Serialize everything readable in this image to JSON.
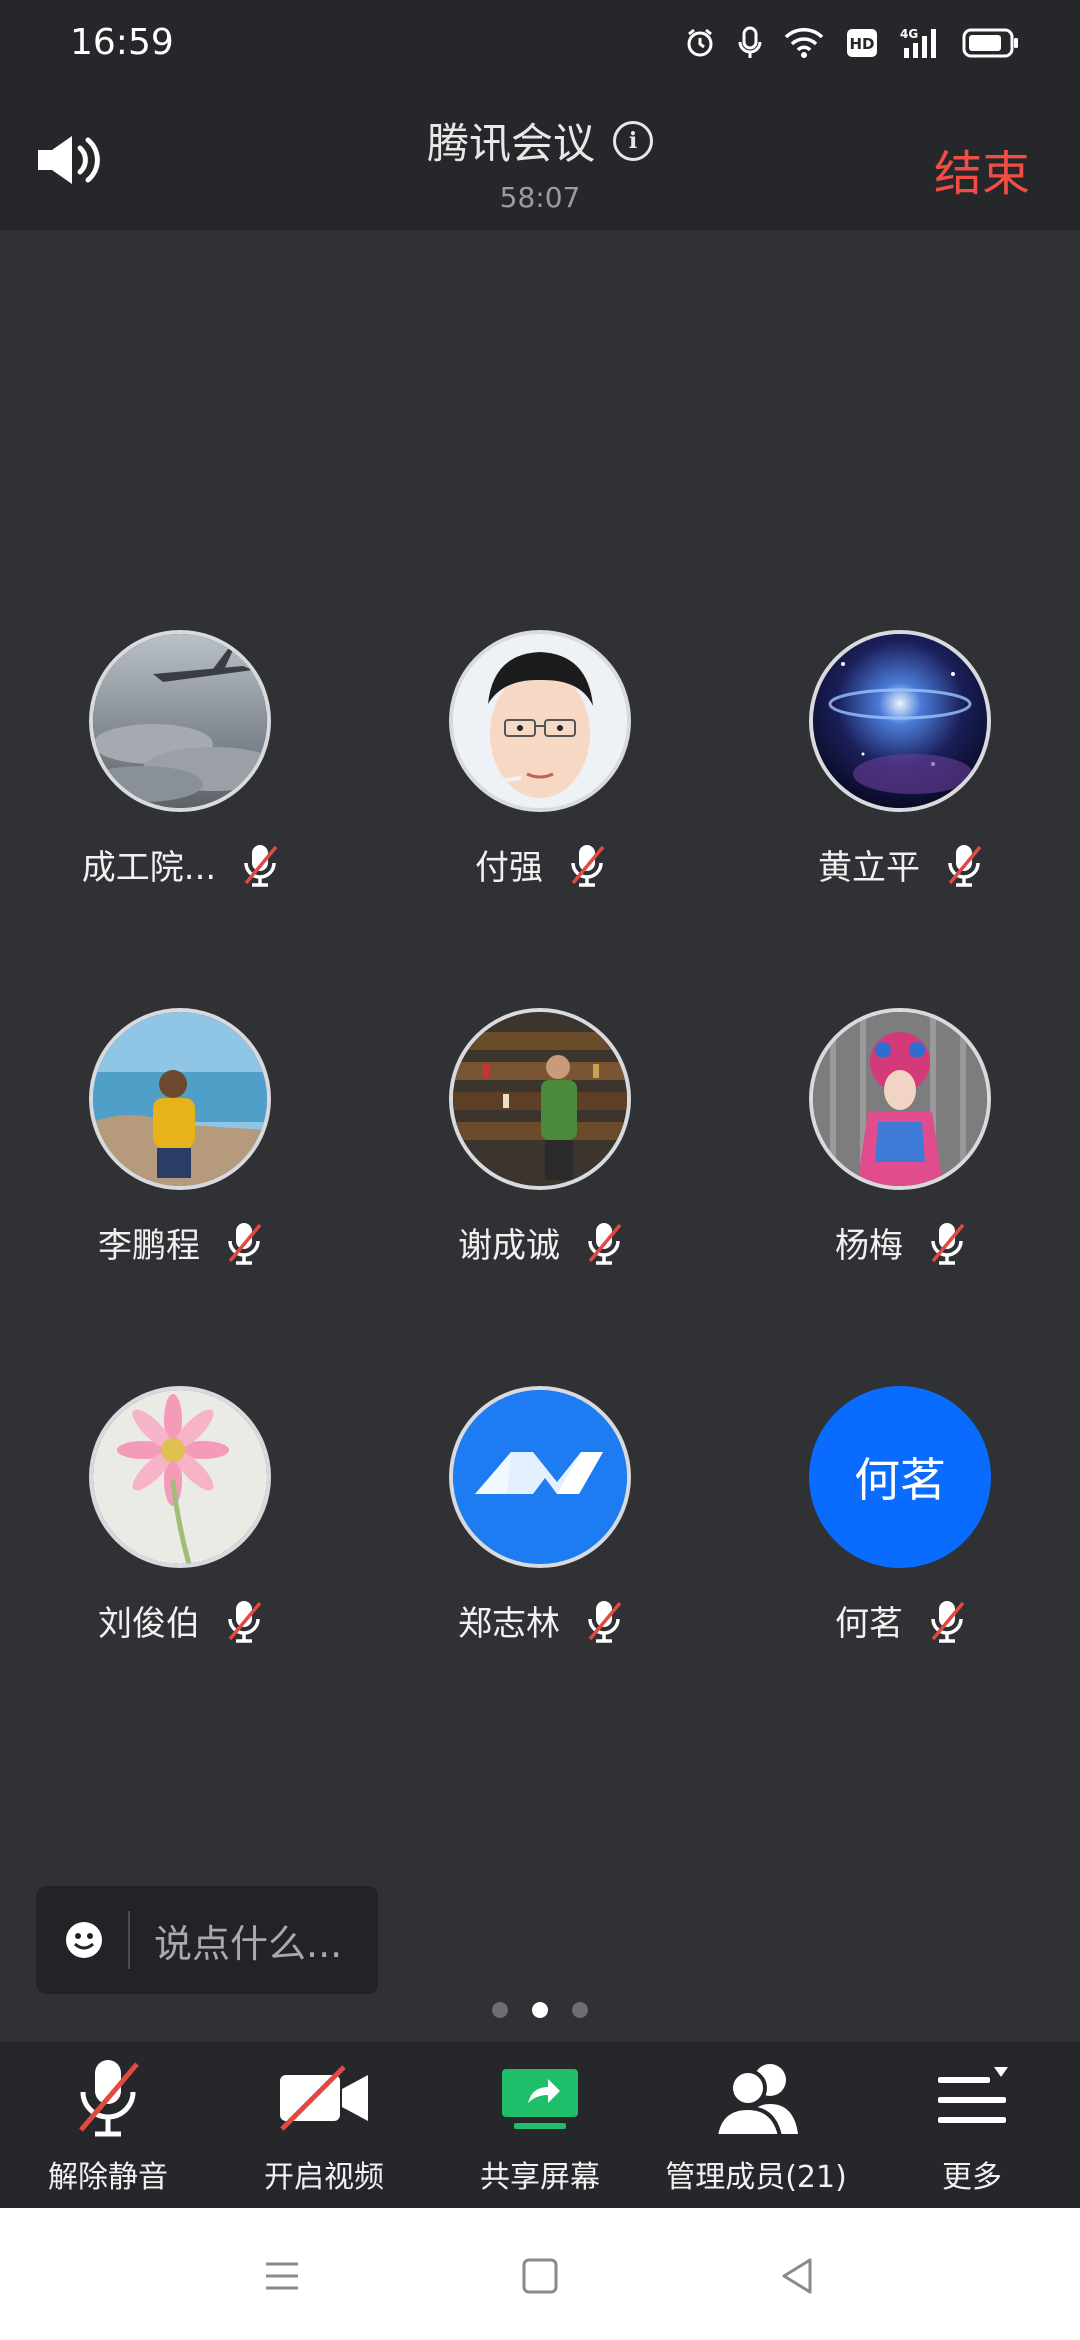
{
  "status_bar": {
    "time": "16:59",
    "icons": [
      "alarm-icon",
      "mic-icon",
      "wifi-icon",
      "hd-icon",
      "signal-4g-icon",
      "battery-icon"
    ]
  },
  "header": {
    "title": "腾讯会议",
    "timer": "58:07",
    "end_label": "结束"
  },
  "participants": [
    {
      "name": "成工院...",
      "avatar": "airplane-clouds",
      "muted": true
    },
    {
      "name": "付强",
      "avatar": "cartoon-face",
      "muted": true
    },
    {
      "name": "黄立平",
      "avatar": "galaxy",
      "muted": true
    },
    {
      "name": "李鹏程",
      "avatar": "person-seaside",
      "muted": true
    },
    {
      "name": "谢成诚",
      "avatar": "person-store",
      "muted": true
    },
    {
      "name": "杨梅",
      "avatar": "opera-costume",
      "muted": true
    },
    {
      "name": "刘俊伯",
      "avatar": "pink-flower",
      "muted": true
    },
    {
      "name": "郑志林",
      "avatar": "tencent-meeting-logo",
      "muted": true
    },
    {
      "name": "何茗",
      "avatar_text": "何茗",
      "muted": true
    }
  ],
  "chat": {
    "placeholder": "说点什么..."
  },
  "pager": {
    "count": 3,
    "active": 2
  },
  "toolbar": [
    {
      "label": "解除静音",
      "icon": "mic-muted-icon"
    },
    {
      "label": "开启视频",
      "icon": "video-off-icon"
    },
    {
      "label": "共享屏幕",
      "icon": "share-screen-icon"
    },
    {
      "label": "管理成员(21)",
      "icon": "members-icon"
    },
    {
      "label": "更多",
      "icon": "more-menu-icon"
    }
  ],
  "colors": {
    "end": "#f04d45",
    "share": "#1fbe6b",
    "avatar_blue": "#0a6cff",
    "mute_slash": "#e04a40"
  }
}
